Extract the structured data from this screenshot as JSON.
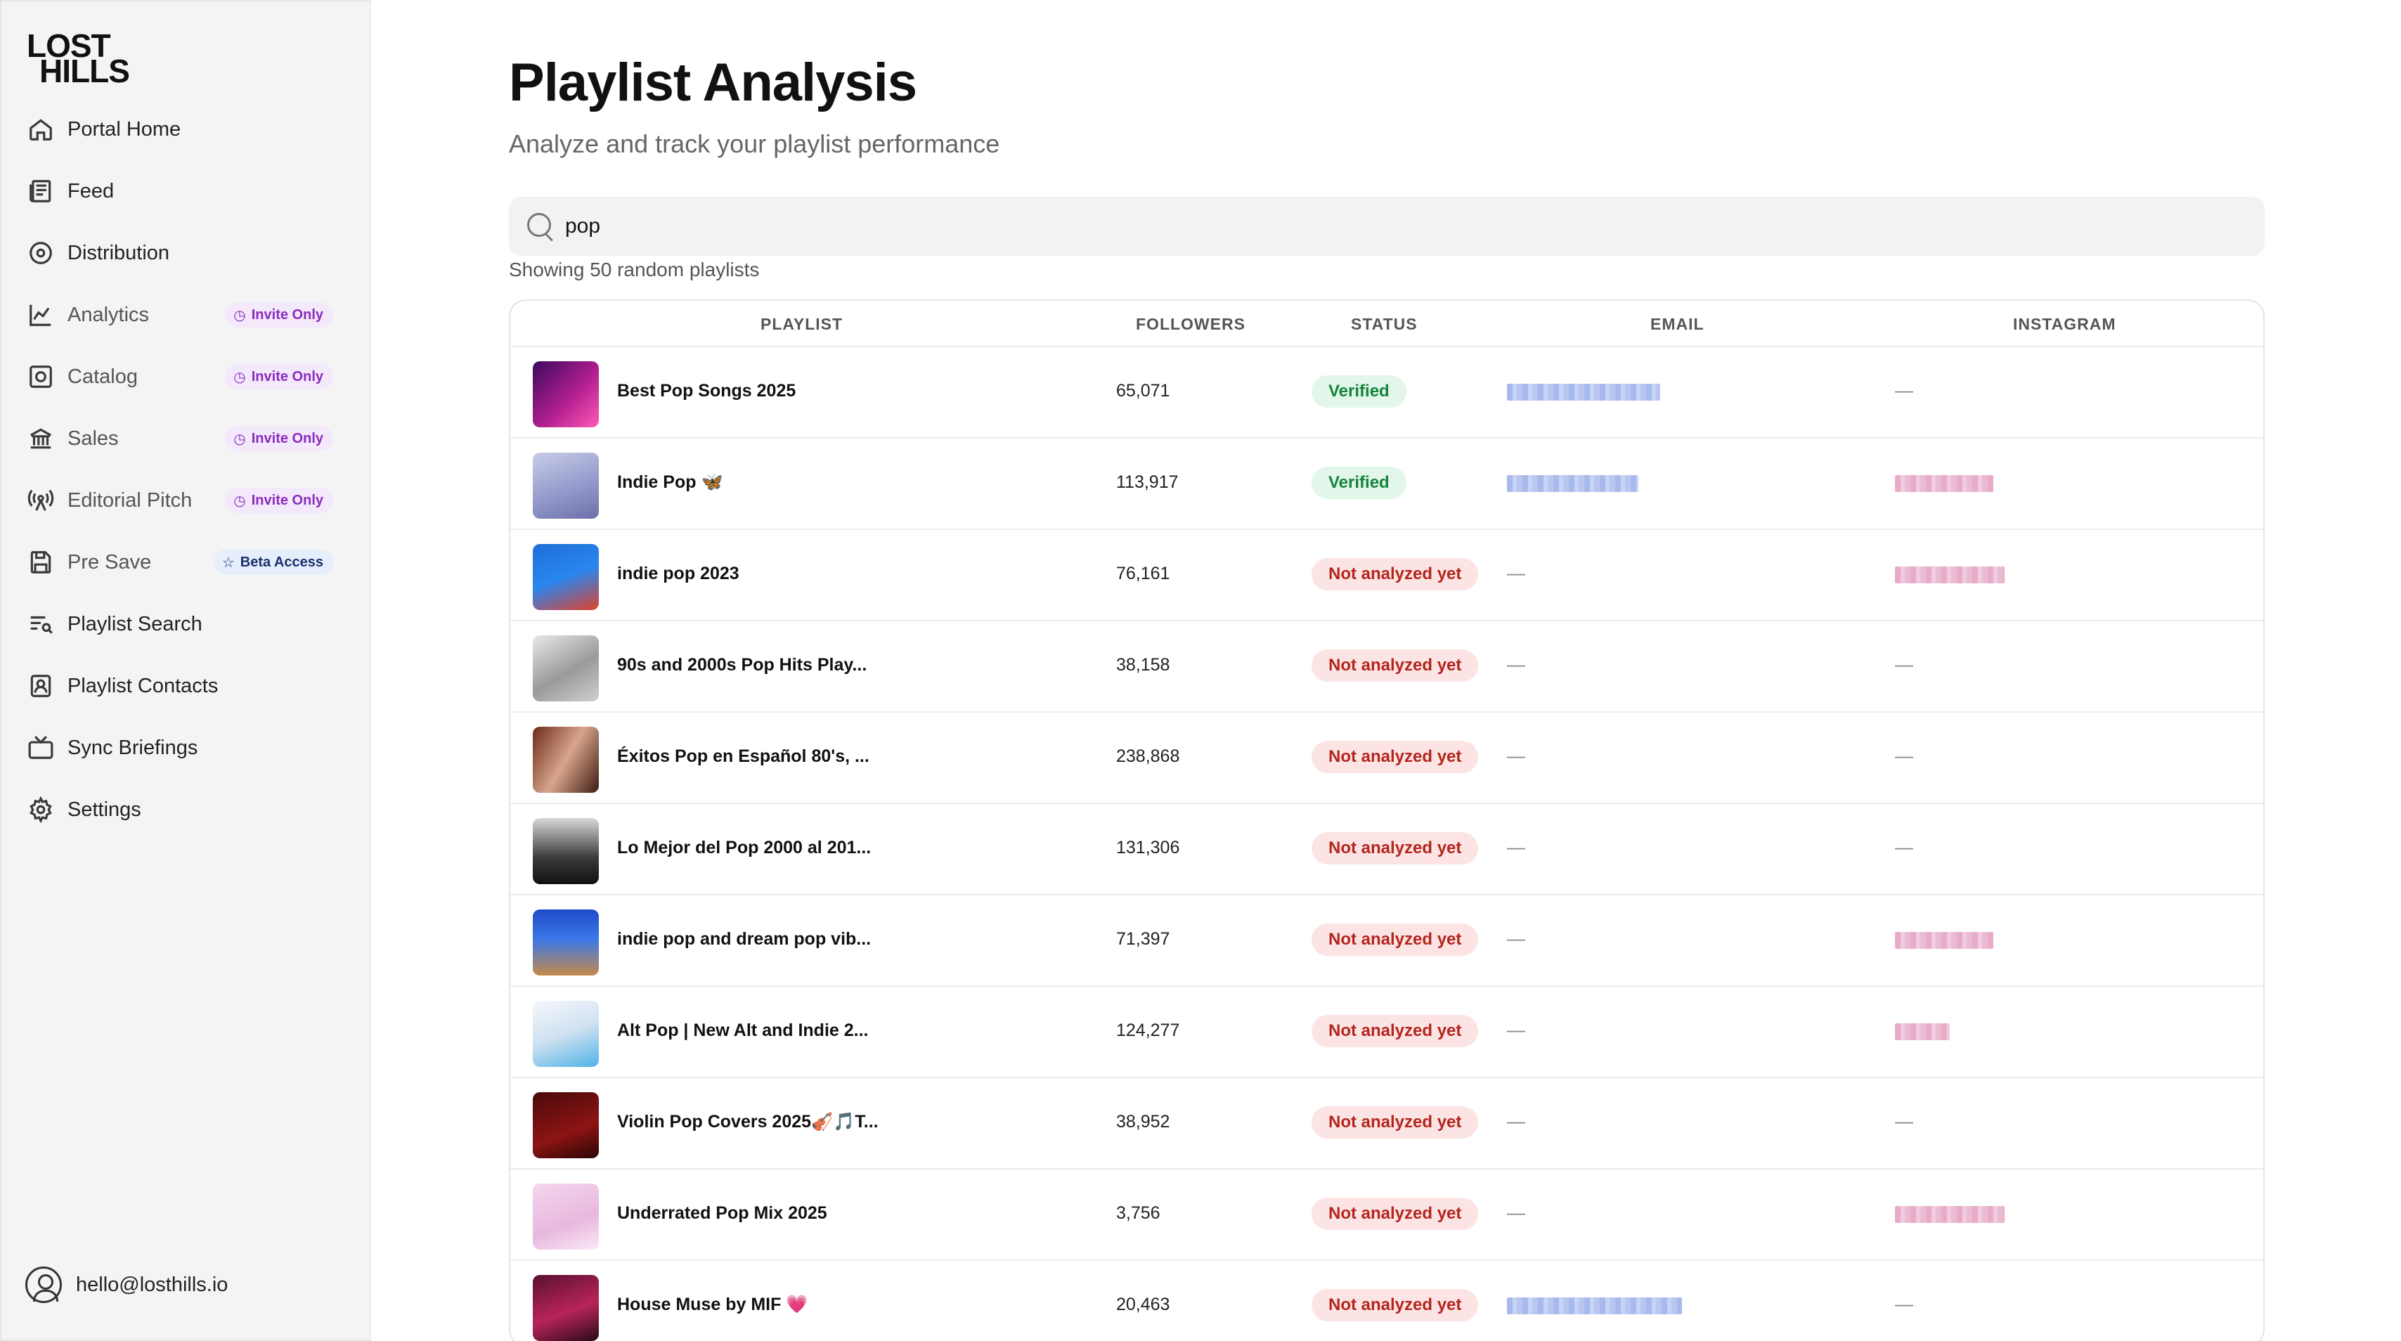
{
  "brand": {
    "line1": "LOST",
    "line2": "HILLS"
  },
  "sidebar": {
    "items": [
      {
        "label": "Portal Home",
        "icon": "home-icon"
      },
      {
        "label": "Feed",
        "icon": "newspaper-icon"
      },
      {
        "label": "Distribution",
        "icon": "disc-icon"
      },
      {
        "label": "Analytics",
        "icon": "chart-line-icon",
        "badge": "Invite Only"
      },
      {
        "label": "Catalog",
        "icon": "catalog-icon",
        "badge": "Invite Only"
      },
      {
        "label": "Sales",
        "icon": "bank-icon",
        "badge": "Invite Only"
      },
      {
        "label": "Editorial Pitch",
        "icon": "broadcast-icon",
        "badge": "Invite Only"
      },
      {
        "label": "Pre Save",
        "icon": "save-icon",
        "badge": "Beta Access"
      },
      {
        "label": "Playlist Search",
        "icon": "playlist-search-icon"
      },
      {
        "label": "Playlist Contacts",
        "icon": "contact-book-icon"
      },
      {
        "label": "Sync Briefings",
        "icon": "tv-icon"
      },
      {
        "label": "Settings",
        "icon": "gear-icon"
      }
    ],
    "user_email": "hello@losthills.io"
  },
  "main": {
    "title": "Playlist Analysis",
    "subtitle": "Analyze and track your playlist performance",
    "search_value": "pop",
    "showing": "Showing 50 random playlists",
    "columns": [
      "PLAYLIST",
      "FOLLOWERS",
      "STATUS",
      "EMAIL",
      "INSTAGRAM"
    ],
    "rows": [
      {
        "name": "Best Pop Songs 2025",
        "followers": "65,071",
        "status": "Verified",
        "email": "██████████████",
        "instagram": "—"
      },
      {
        "name": "Indie Pop 🦋",
        "followers": "113,917",
        "status": "Verified",
        "email": "████████████",
        "instagram": "█████████"
      },
      {
        "name": "indie pop 2023",
        "followers": "76,161",
        "status": "Not analyzed yet",
        "email": "—",
        "instagram": "██████████"
      },
      {
        "name": "90s and 2000s Pop Hits Play...",
        "followers": "38,158",
        "status": "Not analyzed yet",
        "email": "—",
        "instagram": "—"
      },
      {
        "name": "Éxitos Pop en Español 80's, ...",
        "followers": "238,868",
        "status": "Not analyzed yet",
        "email": "—",
        "instagram": "—"
      },
      {
        "name": "Lo Mejor del Pop 2000 al 201...",
        "followers": "131,306",
        "status": "Not analyzed yet",
        "email": "—",
        "instagram": "—"
      },
      {
        "name": "indie pop and dream pop vib...",
        "followers": "71,397",
        "status": "Not analyzed yet",
        "email": "—",
        "instagram": "█████████"
      },
      {
        "name": "Alt Pop | New Alt and Indie 2...",
        "followers": "124,277",
        "status": "Not analyzed yet",
        "email": "—",
        "instagram": "█████"
      },
      {
        "name": "Violin Pop Covers 2025🎻🎵T...",
        "followers": "38,952",
        "status": "Not analyzed yet",
        "email": "—",
        "instagram": "—"
      },
      {
        "name": "Underrated Pop Mix 2025",
        "followers": "3,756",
        "status": "Not analyzed yet",
        "email": "—",
        "instagram": "██████████"
      },
      {
        "name": "House Muse by MIF 💗",
        "followers": "20,463",
        "status": "Not analyzed yet",
        "email": "████████████████",
        "instagram": "—"
      }
    ]
  },
  "colors": {
    "verified_bg": "#e2f6e9",
    "verified_text": "#16833d",
    "notyet_bg": "#fde4e4",
    "notyet_text": "#b3261e",
    "invite_text": "#8a2cbf",
    "beta_text": "#1b2f6b"
  }
}
